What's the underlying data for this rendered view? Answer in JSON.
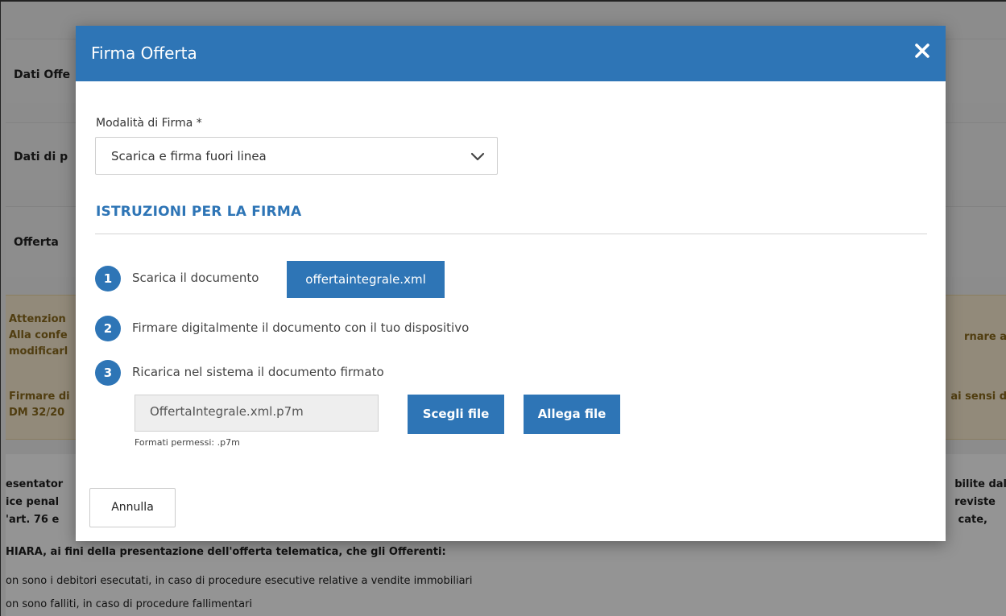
{
  "background": {
    "rows": [
      "Dati Offe",
      "Dati di p",
      "Offerta"
    ],
    "warning_left": [
      "Attenzion",
      "Alla confe",
      "modificarl",
      "",
      "Firmare di",
      "DM 32/20"
    ],
    "warning_right": [
      "",
      "rnare a",
      "",
      "",
      "ai sensi d"
    ],
    "text_left": [
      "esentator",
      "ice penal",
      "'art. 76 e"
    ],
    "text_right": [
      "bilite dal",
      "reviste",
      "cate,"
    ],
    "text_line4_left": "HIARA, ai",
    "text_line4_bold": "fini della presentazione dell'offerta telematica, che gli Offerenti:",
    "text_line5": "on sono i debitori esecutati, in caso di procedure esecutive relative a vendite immobiliari",
    "text_line6": "on sono falliti, in caso di procedure fallimentari"
  },
  "modal": {
    "title": "Firma Offerta",
    "close_icon": "close-icon",
    "field_label": "Modalità di Firma *",
    "select_value": "Scarica e firma fuori linea",
    "section_title": "ISTRUZIONI PER LA FIRMA",
    "steps": [
      {
        "num": "1",
        "text": "Scarica il documento"
      },
      {
        "num": "2",
        "text": "Firmare digitalmente il documento con il tuo dispositivo"
      },
      {
        "num": "3",
        "text": "Ricarica nel sistema il documento firmato"
      }
    ],
    "document_button": "offertaintegrale.xml",
    "file_value": "OffertaIntegrale.xml.p7m",
    "choose_button": "Scegli file",
    "attach_button": "Allega file",
    "help_text": "Formati permessi: .p7m",
    "cancel_button": "Annulla"
  },
  "colors": {
    "primary": "#2e75b6",
    "warning_bg": "#fbeed2",
    "warning_text": "#8a6a1c"
  }
}
